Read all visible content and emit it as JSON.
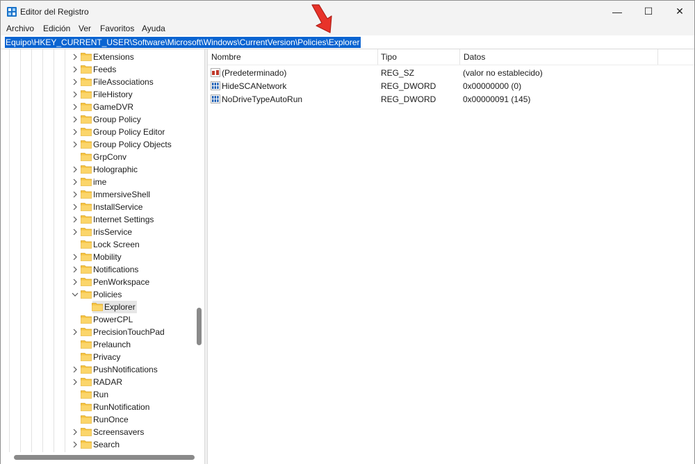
{
  "window": {
    "title": "Editor del Registro",
    "minimize_glyph": "—",
    "maximize_glyph": "☐",
    "close_glyph": "✕"
  },
  "menu": [
    "Archivo",
    "Edición",
    "Ver",
    "Favoritos",
    "Ayuda"
  ],
  "address": "Equipo\\HKEY_CURRENT_USER\\Software\\Microsoft\\Windows\\CurrentVersion\\Policies\\Explorer",
  "tree": {
    "items": [
      {
        "label": "Extensions",
        "expander": "collapsed",
        "depth": 0
      },
      {
        "label": "Feeds",
        "expander": "collapsed",
        "depth": 0
      },
      {
        "label": "FileAssociations",
        "expander": "collapsed",
        "depth": 0
      },
      {
        "label": "FileHistory",
        "expander": "collapsed",
        "depth": 0
      },
      {
        "label": "GameDVR",
        "expander": "collapsed",
        "depth": 0
      },
      {
        "label": "Group Policy",
        "expander": "collapsed",
        "depth": 0
      },
      {
        "label": "Group Policy Editor",
        "expander": "collapsed",
        "depth": 0
      },
      {
        "label": "Group Policy Objects",
        "expander": "collapsed",
        "depth": 0
      },
      {
        "label": "GrpConv",
        "expander": "none",
        "depth": 0
      },
      {
        "label": "Holographic",
        "expander": "collapsed",
        "depth": 0
      },
      {
        "label": "ime",
        "expander": "collapsed",
        "depth": 0
      },
      {
        "label": "ImmersiveShell",
        "expander": "collapsed",
        "depth": 0
      },
      {
        "label": "InstallService",
        "expander": "collapsed",
        "depth": 0
      },
      {
        "label": "Internet Settings",
        "expander": "collapsed",
        "depth": 0
      },
      {
        "label": "IrisService",
        "expander": "collapsed",
        "depth": 0
      },
      {
        "label": "Lock Screen",
        "expander": "none",
        "depth": 0
      },
      {
        "label": "Mobility",
        "expander": "collapsed",
        "depth": 0
      },
      {
        "label": "Notifications",
        "expander": "collapsed",
        "depth": 0
      },
      {
        "label": "PenWorkspace",
        "expander": "collapsed",
        "depth": 0
      },
      {
        "label": "Policies",
        "expander": "expanded",
        "depth": 0
      },
      {
        "label": "Explorer",
        "expander": "none",
        "depth": 1,
        "selected": true
      },
      {
        "label": "PowerCPL",
        "expander": "none",
        "depth": 0
      },
      {
        "label": "PrecisionTouchPad",
        "expander": "collapsed",
        "depth": 0
      },
      {
        "label": "Prelaunch",
        "expander": "none",
        "depth": 0
      },
      {
        "label": "Privacy",
        "expander": "none",
        "depth": 0
      },
      {
        "label": "PushNotifications",
        "expander": "collapsed",
        "depth": 0
      },
      {
        "label": "RADAR",
        "expander": "collapsed",
        "depth": 0
      },
      {
        "label": "Run",
        "expander": "none",
        "depth": 0
      },
      {
        "label": "RunNotification",
        "expander": "none",
        "depth": 0
      },
      {
        "label": "RunOnce",
        "expander": "none",
        "depth": 0
      },
      {
        "label": "Screensavers",
        "expander": "collapsed",
        "depth": 0
      },
      {
        "label": "Search",
        "expander": "collapsed",
        "depth": 0
      }
    ]
  },
  "list": {
    "columns": [
      "Nombre",
      "Tipo",
      "Datos"
    ],
    "rows": [
      {
        "icon": "string-value-icon",
        "name": "(Predeterminado)",
        "type": "REG_SZ",
        "data": "(valor no establecido)"
      },
      {
        "icon": "dword-value-icon",
        "name": "HideSCANetwork",
        "type": "REG_DWORD",
        "data": "0x00000000 (0)"
      },
      {
        "icon": "dword-value-icon",
        "name": "NoDriveTypeAutoRun",
        "type": "REG_DWORD",
        "data": "0x00000091 (145)"
      }
    ]
  },
  "colors": {
    "accent_selection": "#0a64d1",
    "folder": "#f6c443",
    "pointer": "#e8332a"
  }
}
